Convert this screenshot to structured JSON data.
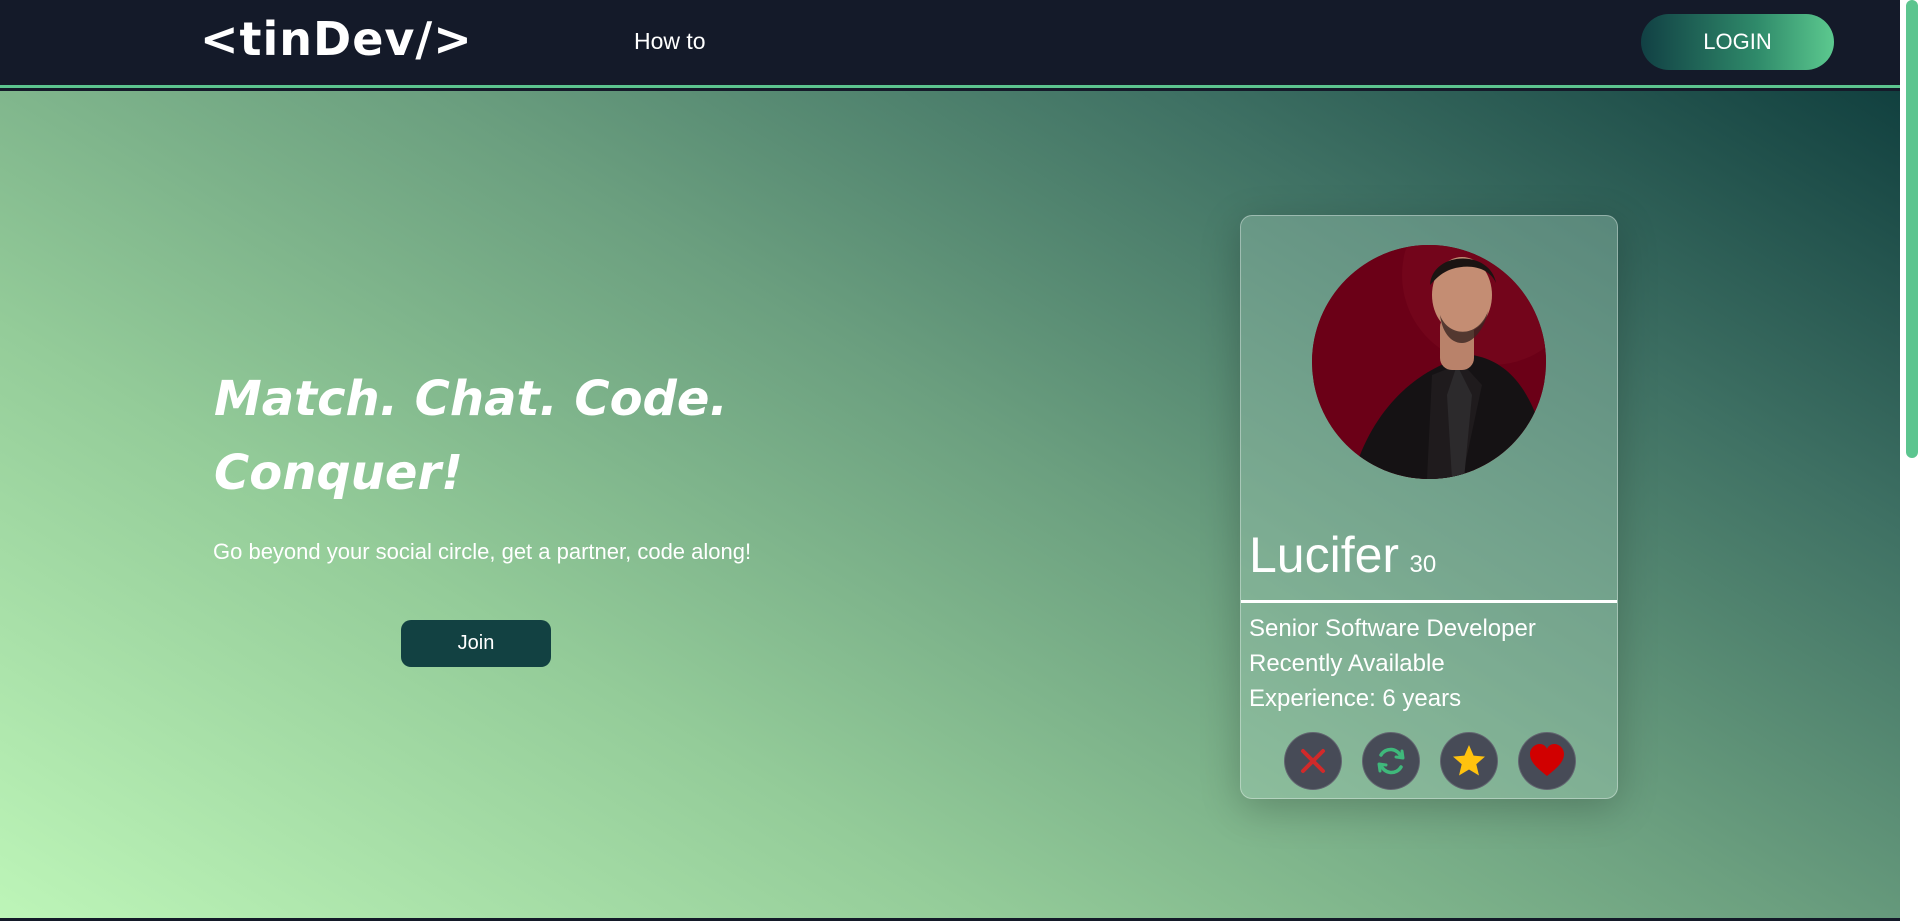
{
  "nav": {
    "logo": "<tinDev/>",
    "links": [
      {
        "label": "How to"
      }
    ],
    "login_label": "LOGIN"
  },
  "hero": {
    "headline": "Match. Chat. Code. Conquer!",
    "subtext": "Go beyond your social circle, get a partner, code along!",
    "join_label": "Join"
  },
  "card": {
    "name": "Lucifer",
    "age": "30",
    "details": [
      "Senior Software Developer",
      "Recently Available",
      "Experience: 6 years"
    ],
    "actions": [
      {
        "icon": "close-icon",
        "color": "#d12a2a"
      },
      {
        "icon": "refresh-icon",
        "color": "#3fb87b"
      },
      {
        "icon": "star-icon",
        "color": "#ffc20e"
      },
      {
        "icon": "heart-icon",
        "color": "#d10000"
      }
    ]
  },
  "colors": {
    "nav_bg": "#141a29",
    "accent": "#5cc58f",
    "join_bg": "#124142",
    "hero_gradient_start": "#bdf5b8",
    "hero_gradient_end": "#11403f"
  }
}
